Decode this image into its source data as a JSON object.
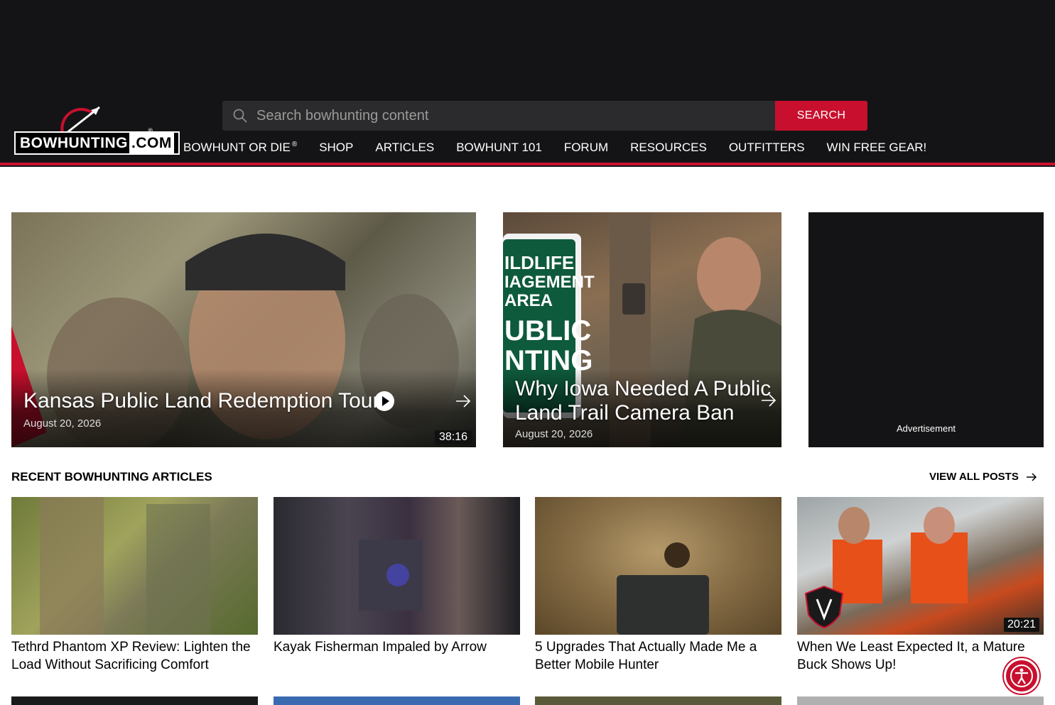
{
  "header": {
    "logo_text": "BOWHUNTING",
    "logo_com": ".COM",
    "logo_reg": "®",
    "search_placeholder": "Search bowhunting content",
    "search_button": "SEARCH",
    "nav": [
      {
        "label": "BOWHUNT OR DIE",
        "sup": "®"
      },
      {
        "label": "SHOP"
      },
      {
        "label": "ARTICLES"
      },
      {
        "label": "BOWHUNT 101"
      },
      {
        "label": "FORUM"
      },
      {
        "label": "RESOURCES"
      },
      {
        "label": "OUTFITTERS"
      },
      {
        "label": "WIN FREE GEAR!"
      }
    ]
  },
  "heroes": [
    {
      "title": "Kansas Public Land Redemption Tour",
      "date": "August 20, 2026",
      "duration": "38:16"
    },
    {
      "title_line1": "Why Iowa Needed A Public",
      "title_line2": "Land Trail Camera Ban",
      "date": "August 20, 2026"
    }
  ],
  "ad": {
    "label": "Advertisement"
  },
  "recent": {
    "title": "RECENT BOWHUNTING ARTICLES",
    "view_all": "VIEW ALL POSTS",
    "cards": [
      {
        "title": "Tethrd Phantom XP Review: Lighten the Load Without Sacrificing Comfort"
      },
      {
        "title": "Kayak Fisherman Impaled by Arrow"
      },
      {
        "title": "5 Upgrades That Actually Made Me a Better Mobile Hunter"
      },
      {
        "title": "When We Least Expected It, a Mature Buck Shows Up!",
        "duration": "20:21"
      }
    ]
  },
  "colors": {
    "accent": "#c8102e",
    "header_bg": "#141416"
  }
}
